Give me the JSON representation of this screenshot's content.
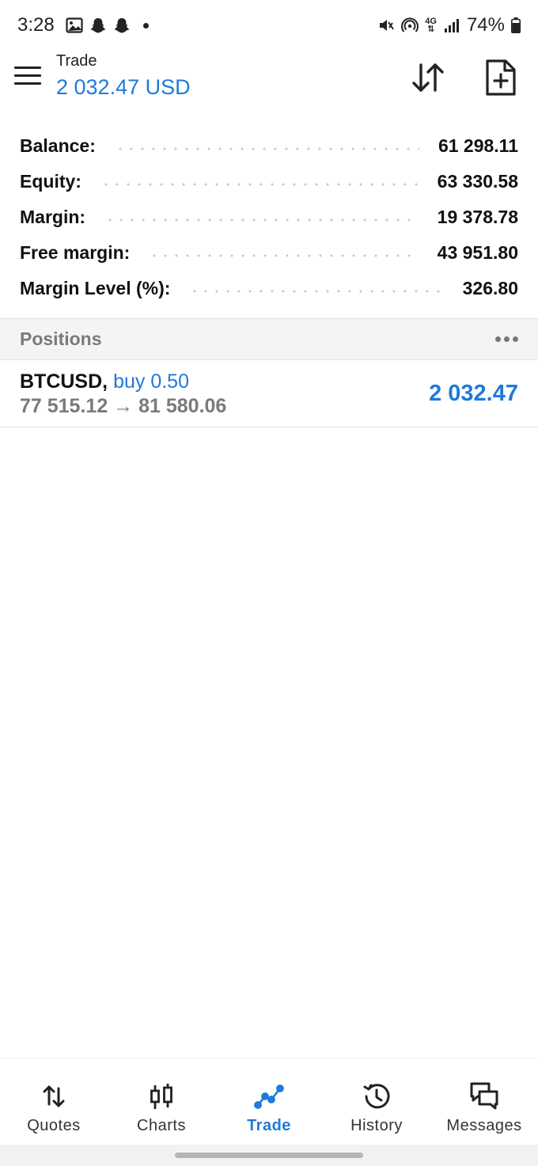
{
  "status_bar": {
    "time": "3:28",
    "network": "4G",
    "battery": "74%"
  },
  "header": {
    "title": "Trade",
    "amount": "2 032.47 USD"
  },
  "summary": [
    {
      "label": "Balance:",
      "value": "61 298.11"
    },
    {
      "label": "Equity:",
      "value": "63 330.58"
    },
    {
      "label": "Margin:",
      "value": "19 378.78"
    },
    {
      "label": "Free margin:",
      "value": "43 951.80"
    },
    {
      "label": "Margin Level (%):",
      "value": "326.80"
    }
  ],
  "positions": {
    "title": "Positions",
    "items": [
      {
        "symbol": "BTCUSD,",
        "side": "buy 0.50",
        "prices": "77 515.12 → 81 580.06",
        "profit": "2 032.47"
      }
    ]
  },
  "nav": {
    "items": [
      {
        "label": "Quotes",
        "icon": "quotes-icon"
      },
      {
        "label": "Charts",
        "icon": "charts-icon"
      },
      {
        "label": "Trade",
        "icon": "trade-icon",
        "active": true
      },
      {
        "label": "History",
        "icon": "history-icon"
      },
      {
        "label": "Messages",
        "icon": "messages-icon"
      }
    ]
  },
  "colors": {
    "accent": "#1f7ad8",
    "muted": "#7a7a7a",
    "section_bg": "#f4f4f4"
  }
}
